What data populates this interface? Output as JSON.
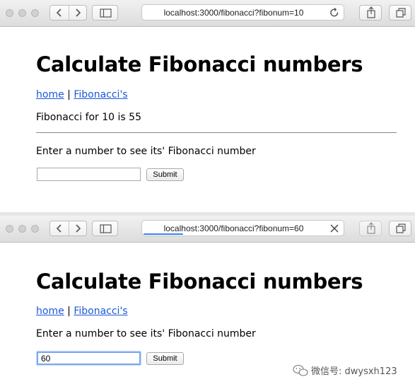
{
  "window1": {
    "url": "localhost:3000/fibonacci?fibonum=10",
    "url_action_icon": "reload-icon",
    "heading": "Calculate Fibonacci numbers",
    "nav": {
      "home": "home",
      "separator": " | ",
      "fib": "Fibonacci's"
    },
    "result": "Fibonacci for 10 is 55",
    "prompt": "Enter a number to see its' Fibonacci number",
    "input": {
      "value": "",
      "placeholder": ""
    },
    "submit_label": "Submit"
  },
  "window2": {
    "url": "localhost:3000/fibonacci?fibonum=60",
    "url_action_icon": "stop-loading-icon",
    "loading": true,
    "heading": "Calculate Fibonacci numbers",
    "nav": {
      "home": "home",
      "separator": " | ",
      "fib": "Fibonacci's"
    },
    "prompt": "Enter a number to see its' Fibonacci number",
    "input": {
      "value": "60",
      "placeholder": ""
    },
    "submit_label": "Submit"
  },
  "watermark": {
    "text": "微信号: dwysxh123",
    "icon": "wechat-icon"
  },
  "colors": {
    "link": "#1a58d8",
    "focus_ring": "#77a7f0",
    "progress": "#3b82f6"
  }
}
